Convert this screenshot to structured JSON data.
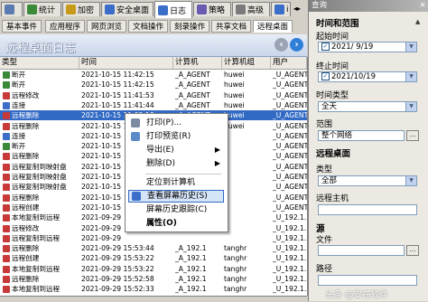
{
  "top_tabs": [
    {
      "label": "",
      "icon": "computer-icon",
      "color": "#5a7ab0"
    },
    {
      "label": "统计",
      "icon": "stats-icon",
      "color": "#3a8a3a"
    },
    {
      "label": "加密",
      "icon": "lock-icon",
      "color": "#c89a1a"
    },
    {
      "label": "安全桌面",
      "icon": "desktop-icon",
      "color": "#3a6ec8"
    },
    {
      "label": "日志",
      "icon": "log-icon",
      "color": "#3a6ec8"
    },
    {
      "label": "策略",
      "icon": "policy-icon",
      "color": "#6a5ab0"
    },
    {
      "label": "高级",
      "icon": "advanced-icon",
      "color": "#7a7a7a"
    },
    {
      "label": "i",
      "icon": "info-icon",
      "color": "#3a6ec8"
    }
  ],
  "sub_tabs": [
    "基本事件",
    "应用程序",
    "网页浏览",
    "文档操作",
    "刻录操作",
    "共享文档",
    "远程桌面"
  ],
  "page": {
    "title": "远程桌面日志"
  },
  "table": {
    "columns": [
      "类型",
      "时间",
      "计算机",
      "计算机组",
      "用户"
    ],
    "rows": [
      {
        "type": "断开",
        "time": "2021-10-15 11:42:15",
        "computer": "_A_AGENT",
        "group": "huwei",
        "user": "_U_AGENT.",
        "icon_color": "#3a8a3a"
      },
      {
        "type": "断开",
        "time": "2021-10-15 11:42:15",
        "computer": "_A_AGENT",
        "group": "huwei",
        "user": "_U_AGENT.",
        "icon_color": "#3a8a3a"
      },
      {
        "type": "远程修改",
        "time": "2021-10-15 11:41:53",
        "computer": "_A_AGENT",
        "group": "huwei",
        "user": "_U_AGENT.",
        "icon_color": "#c83a3a"
      },
      {
        "type": "连接",
        "time": "2021-10-15 11:41:44",
        "computer": "_A_AGENT",
        "group": "huwei",
        "user": "_U_AGENT.",
        "icon_color": "#3a6ec8"
      },
      {
        "type": "远程删除",
        "time": "2021-10-15 11:35:18",
        "computer": "_A_AGENT",
        "group": "huwei",
        "user": "_U_AGENT.",
        "icon_color": "#c83a3a"
      },
      {
        "type": "远程删除",
        "time": "2021-10-15 11:35:08",
        "computer": "_A_AGENT",
        "group": "huwei",
        "user": "_U_AGENT.",
        "icon_color": "#c83a3a"
      },
      {
        "type": "连接",
        "time": "2021-10-15",
        "computer": "",
        "group": "",
        "user": "_U_AGENT.",
        "icon_color": "#3a6ec8"
      },
      {
        "type": "断开",
        "time": "2021-10-15",
        "computer": "",
        "group": "",
        "user": "_U_AGENT.",
        "icon_color": "#3a8a3a"
      },
      {
        "type": "远程删除",
        "time": "2021-10-15",
        "computer": "",
        "group": "",
        "user": "_U_AGENT.",
        "icon_color": "#c83a3a"
      },
      {
        "type": "远程复制到映射盘",
        "time": "2021-10-15",
        "computer": "",
        "group": "",
        "user": "_U_AGENT.",
        "icon_color": "#c83a3a"
      },
      {
        "type": "远程复制到映射盘",
        "time": "2021-10-15",
        "computer": "",
        "group": "",
        "user": "_U_AGENT.",
        "icon_color": "#c83a3a"
      },
      {
        "type": "远程复制到映射盘",
        "time": "2021-10-15",
        "computer": "",
        "group": "",
        "user": "_U_AGENT.",
        "icon_color": "#c83a3a"
      },
      {
        "type": "远程删除",
        "time": "2021-10-15",
        "computer": "",
        "group": "",
        "user": "_U_AGENT.",
        "icon_color": "#c83a3a"
      },
      {
        "type": "远程创建",
        "time": "2021-10-15",
        "computer": "",
        "group": "",
        "user": "_U_AGENT.",
        "icon_color": "#c83a3a"
      },
      {
        "type": "本地复制到远程",
        "time": "2021-09-29",
        "computer": "",
        "group": "",
        "user": "_U_192.1.",
        "icon_color": "#c83a3a"
      },
      {
        "type": "远程修改",
        "time": "2021-09-29",
        "computer": "",
        "group": "",
        "user": "_U_192.1.",
        "icon_color": "#c83a3a"
      },
      {
        "type": "远程复制到远程",
        "time": "2021-09-29",
        "computer": "",
        "group": "",
        "user": "_U_192.1.",
        "icon_color": "#c83a3a"
      },
      {
        "type": "远程删除",
        "time": "2021-09-29 15:53:44",
        "computer": "_A_192.1",
        "group": "tanghr",
        "user": "_U_192.1.",
        "icon_color": "#c83a3a"
      },
      {
        "type": "远程创建",
        "time": "2021-09-29 15:53:22",
        "computer": "_A_192.1",
        "group": "tanghr",
        "user": "_U_192.1.",
        "icon_color": "#c83a3a"
      },
      {
        "type": "本地复制到远程",
        "time": "2021-09-29 15:53:22",
        "computer": "_A_192.1",
        "group": "tanghr",
        "user": "_U_192.1.",
        "icon_color": "#c83a3a"
      },
      {
        "type": "远程删除",
        "time": "2021-09-29 15:52:58",
        "computer": "_A_192.1",
        "group": "tanghr",
        "user": "_U_192.1.",
        "icon_color": "#c83a3a"
      },
      {
        "type": "本地复制到远程",
        "time": "2021-09-29 15:52:33",
        "computer": "_A_192.1",
        "group": "tanghr",
        "user": "_U_192.1.",
        "icon_color": "#c83a3a"
      },
      {
        "type": "远程删除",
        "time": "2021-09-29 15:52:20",
        "computer": "_A_192.1",
        "group": "tanghr",
        "user": "_U_192.1.",
        "icon_color": "#c83a3a"
      }
    ],
    "selected_row": 4
  },
  "context_menu": {
    "items": [
      {
        "label": "打印(P)...",
        "icon": "print-icon"
      },
      {
        "label": "打印预览(R)",
        "icon": "print-preview-icon"
      },
      {
        "label": "导出(E)",
        "icon": "",
        "arrow": "▶"
      },
      {
        "label": "删除(D)",
        "icon": "",
        "arrow": "▶"
      },
      {
        "label": "定位到计算机",
        "icon": ""
      },
      {
        "label": "查看屏幕历史(S)",
        "icon": "screen-history-icon"
      },
      {
        "label": "屏幕历史跟踪(C)",
        "icon": ""
      },
      {
        "label": "属性(O)",
        "icon": ""
      }
    ],
    "highlighted": 5
  },
  "right_panel": {
    "title": "查询",
    "section_time": "时间和范围",
    "start_label": "起始时间",
    "start_value": "2021/ 9/19",
    "end_label": "终止时间",
    "end_value": "2021/10/19",
    "time_type_label": "时间类型",
    "time_type_value": "全天",
    "scope_label": "范围",
    "scope_value": "整个网络",
    "section_rdp": "远程桌面",
    "type_label": "类型",
    "type_value": "全部",
    "host_label": "远程主机",
    "section_source": "源",
    "file_label": "文件",
    "path_label": "路径"
  },
  "watermark": "头条 @安在软件"
}
